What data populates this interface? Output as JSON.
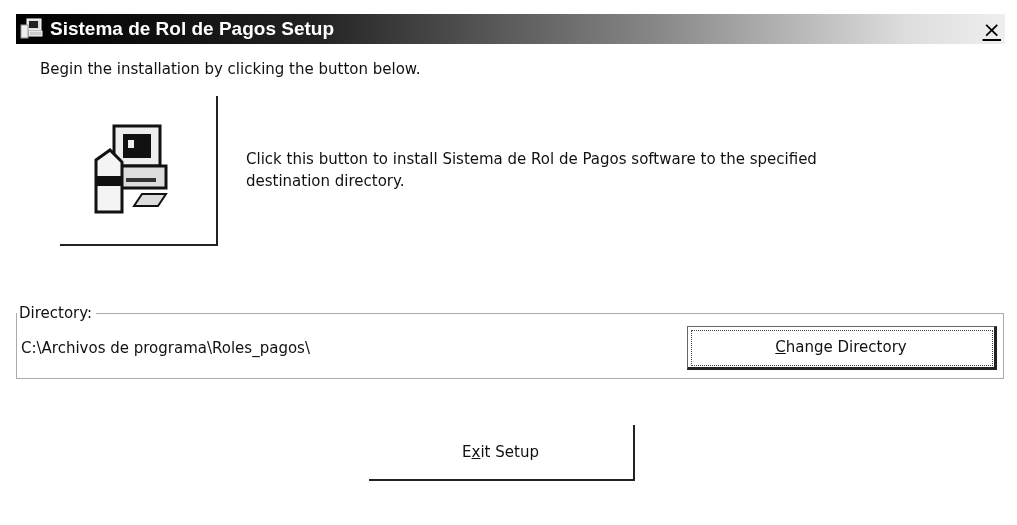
{
  "window": {
    "title": "Sistema de Rol de Pagos Setup",
    "close": "×"
  },
  "intro": "Begin the installation by clicking the button below.",
  "install": {
    "description": "Click this button to install Sistema de Rol de Pagos software to the specified destination directory."
  },
  "directory": {
    "legend": "Directory:",
    "path": "C:\\Archivos de programa\\Roles_pagos\\",
    "button": {
      "key": "C",
      "after": "hange Directory",
      "focused": true
    }
  },
  "exit_button": {
    "before": "E",
    "key": "x",
    "after": "it Setup",
    "focused": false
  }
}
